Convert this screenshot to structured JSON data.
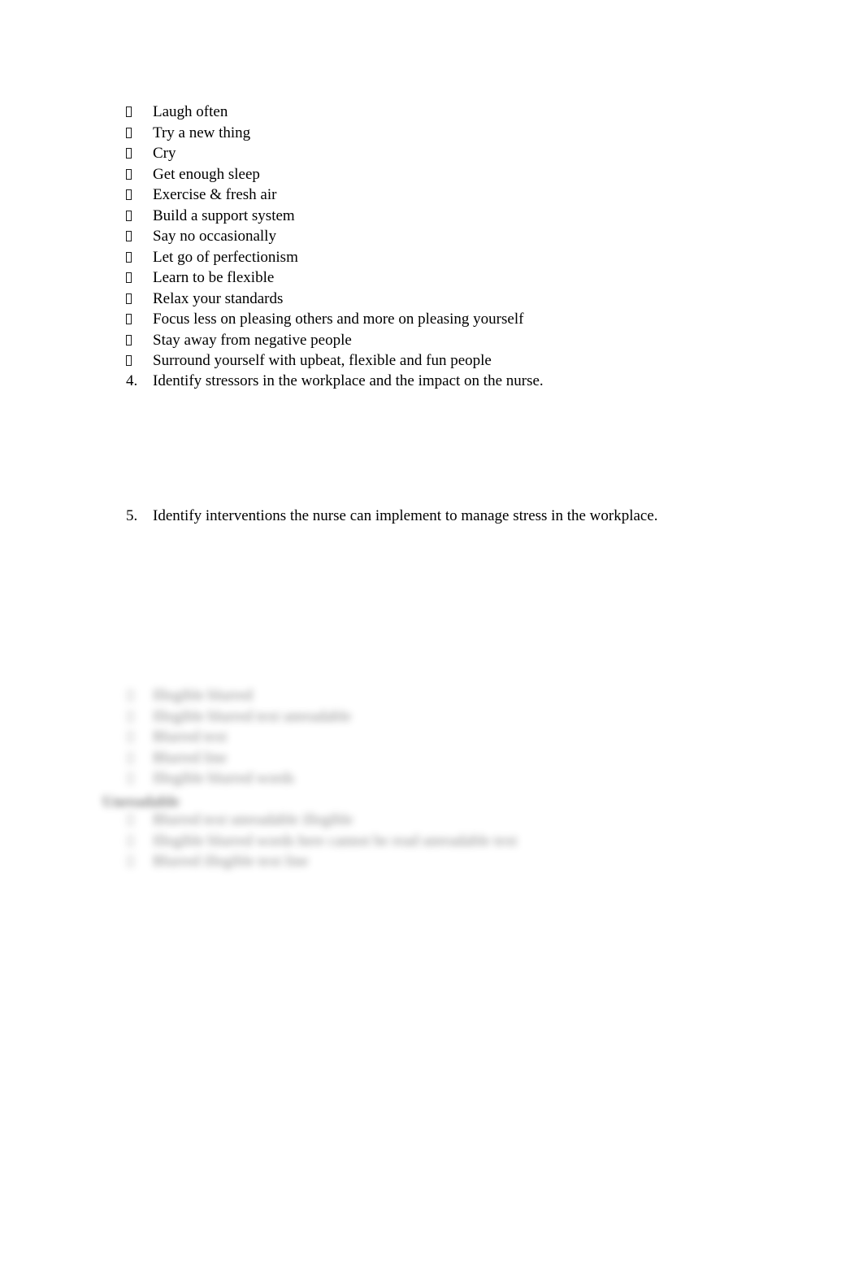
{
  "document": {
    "page_background": "#ffffff",
    "text_color": "#000000",
    "bullet_glyph": "notdef-box",
    "bullet_list": {
      "items": [
        {
          "text": "Laugh often"
        },
        {
          "text": "Try a new thing"
        },
        {
          "text": "Cry"
        },
        {
          "text": "Get enough sleep"
        },
        {
          "text": "Exercise & fresh air"
        },
        {
          "text": "Build a support system"
        },
        {
          "text": "Say no occasionally"
        },
        {
          "text": "Let go of perfectionism"
        },
        {
          "text": "Learn to be flexible"
        },
        {
          "text": "Relax your standards"
        },
        {
          "text": "Focus less on pleasing others and more on pleasing yourself"
        },
        {
          "text": "Stay away from negative people"
        },
        {
          "text": "Surround yourself with upbeat, flexible and fun people"
        }
      ]
    },
    "numbered_items": [
      {
        "number": "4.",
        "text": "Identify stressors in the workplace and the impact on the nurse."
      },
      {
        "number": "5.",
        "text": "Identify interventions the nurse can implement to manage stress in the workplace."
      }
    ],
    "obscured_section": {
      "note": "blurred / illegible region",
      "margin_word": "Unreadable",
      "lines": [
        {
          "bullet": true,
          "text": "Illegible blurred"
        },
        {
          "bullet": true,
          "text": "Illegible blurred text unreadable"
        },
        {
          "bullet": true,
          "text": "Blurred text"
        },
        {
          "bullet": true,
          "text": "Blurred line"
        },
        {
          "bullet": true,
          "text": "Illegible blurred words"
        },
        {
          "bullet": false,
          "text": ""
        },
        {
          "bullet": true,
          "text": "Blurred text unreadable illegible"
        },
        {
          "bullet": true,
          "text": "Illegible blurred words here cannot be read unreadable text"
        },
        {
          "bullet": true,
          "text": "Blurred illegible text line"
        }
      ]
    }
  }
}
